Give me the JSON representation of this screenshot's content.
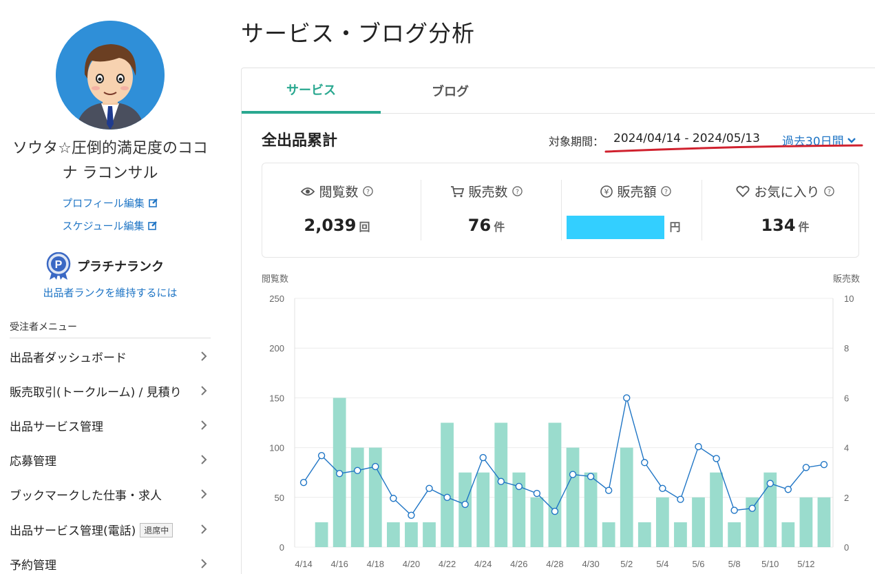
{
  "sidebar": {
    "profile_name": "ソウタ☆圧倒的満足度のココナ ラコンサル",
    "profile_edit": "プロフィール編集",
    "schedule_edit": "スケジュール編集",
    "rank": "プラチナランク",
    "rank_help": "出品者ランクを維持するには",
    "menu_header": "受注者メニュー",
    "menu": [
      {
        "label": "出品者ダッシュボード"
      },
      {
        "label": "販売取引(トークルーム) / 見積り"
      },
      {
        "label": "出品サービス管理"
      },
      {
        "label": "応募管理"
      },
      {
        "label": "ブックマークした仕事・求人"
      },
      {
        "label": "出品サービス管理(電話)",
        "badge": "退席中"
      },
      {
        "label": "予約管理"
      }
    ]
  },
  "main": {
    "title": "サービス・ブログ分析",
    "tabs": [
      {
        "label": "サービス",
        "active": true
      },
      {
        "label": "ブログ",
        "active": false
      }
    ],
    "section_title": "全出品累計",
    "period_label": "対象期間：",
    "period_value": "2024/04/14 - 2024/05/13",
    "period_select": "過去30日間",
    "stats": [
      {
        "label": "閲覧数",
        "value": "2,039",
        "unit": "回",
        "icon": "eye-icon"
      },
      {
        "label": "販売数",
        "value": "76",
        "unit": "件",
        "icon": "cart-icon"
      },
      {
        "label": "販売額",
        "value": "",
        "unit": "円",
        "icon": "yen-icon"
      },
      {
        "label": "お気に入り",
        "value": "134",
        "unit": "件",
        "icon": "heart-icon"
      }
    ]
  },
  "colors": {
    "accent": "#2aa890",
    "link": "#1f75c5",
    "bar": "#9adccd",
    "line": "#1f75c5",
    "redact": "#33cfff",
    "underline": "#d0212e"
  },
  "chart_data": {
    "type": "bar",
    "left_axis_label": "閲覧数",
    "right_axis_label": "販売数",
    "left_ylim": [
      0,
      250
    ],
    "left_ticks": [
      0,
      50,
      100,
      150,
      200,
      250
    ],
    "right_ylim": [
      0,
      10
    ],
    "right_ticks": [
      0,
      2,
      4,
      6,
      8,
      10
    ],
    "x": [
      "4/14",
      "4/15",
      "4/16",
      "4/17",
      "4/18",
      "4/19",
      "4/20",
      "4/21",
      "4/22",
      "4/23",
      "4/24",
      "4/25",
      "4/26",
      "4/27",
      "4/28",
      "4/29",
      "4/30",
      "5/1",
      "5/2",
      "5/3",
      "5/4",
      "5/5",
      "5/6",
      "5/7",
      "5/8",
      "5/9",
      "5/10",
      "5/11",
      "5/12",
      "5/13"
    ],
    "x_tick_labels": [
      "4/14",
      "",
      "4/16",
      "",
      "4/18",
      "",
      "4/20",
      "",
      "4/22",
      "",
      "4/24",
      "",
      "4/26",
      "",
      "4/28",
      "",
      "4/30",
      "",
      "5/2",
      "",
      "5/4",
      "",
      "5/6",
      "",
      "5/8",
      "",
      "5/10",
      "",
      "5/12",
      ""
    ],
    "series": [
      {
        "name": "販売数",
        "kind": "bar",
        "axis": "right",
        "values": [
          0,
          1,
          6,
          4,
          4,
          1,
          1,
          1,
          5,
          3,
          3,
          5,
          3,
          2,
          5,
          4,
          3,
          1,
          4,
          1,
          2,
          1,
          2,
          3,
          1,
          2,
          3,
          1,
          2,
          2
        ]
      },
      {
        "name": "閲覧数",
        "kind": "line",
        "axis": "left",
        "values": [
          65,
          92,
          74,
          77,
          81,
          49,
          32,
          59,
          50,
          43,
          90,
          66,
          61,
          54,
          36,
          73,
          71,
          57,
          150,
          85,
          59,
          48,
          101,
          89,
          37,
          39,
          64,
          58,
          80,
          83
        ]
      }
    ],
    "grid": true
  }
}
